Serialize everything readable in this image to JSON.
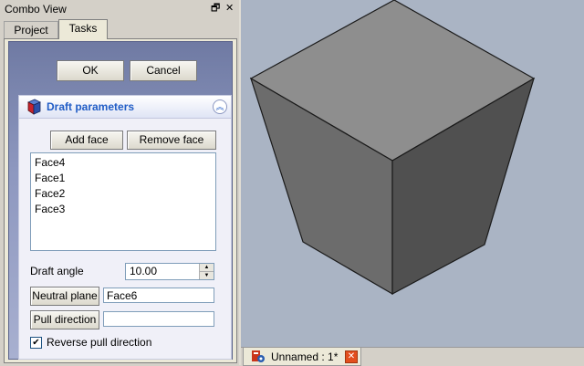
{
  "combo": {
    "title": "Combo View",
    "float_glyph": "🗗",
    "close_glyph": "✕",
    "tabs": [
      {
        "label": "Project"
      },
      {
        "label": "Tasks"
      }
    ],
    "ok_label": "OK",
    "cancel_label": "Cancel"
  },
  "task": {
    "title": "Draft parameters",
    "collapse_glyph": "︽",
    "add_face_label": "Add face",
    "remove_face_label": "Remove face",
    "faces": [
      "Face4",
      "Face1",
      "Face2",
      "Face3"
    ],
    "draft_angle_label": "Draft angle",
    "draft_angle_value": "10.00",
    "neutral_plane_label": "Neutral plane",
    "neutral_plane_value": "Face6",
    "pull_direction_label": "Pull direction",
    "pull_direction_value": "",
    "reverse_label": "Reverse pull direction",
    "reverse_checked": true,
    "check_glyph": "✔"
  },
  "document": {
    "tab_label": "Unnamed : 1*",
    "close_glyph": "✕"
  },
  "colors": {
    "view_background": "#aab4c4",
    "cube_top": "#8c8c8c",
    "cube_left": "#6a6a6a",
    "cube_right": "#4f4f4f",
    "accent_title": "#215dc6"
  },
  "icons": [
    "close-icon",
    "float-icon",
    "cube-icon",
    "collapse-icon",
    "freecad-document-icon",
    "tab-close-icon",
    "spin-up-icon",
    "spin-down-icon",
    "checkmark-icon"
  ]
}
